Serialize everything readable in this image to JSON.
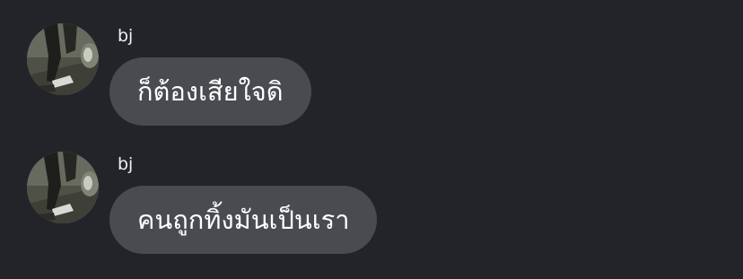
{
  "conversation": {
    "messages": [
      {
        "sender": "bj",
        "avatar": "user-avatar-photo",
        "text": "ก็ต้องเสียใจดิ"
      },
      {
        "sender": "bj",
        "avatar": "user-avatar-photo",
        "text": "คนถูกทิ้งมันเป็นเรา"
      }
    ]
  },
  "colors": {
    "background": "#232429",
    "bubble": "#4a4b51",
    "text": "#ffffff"
  }
}
